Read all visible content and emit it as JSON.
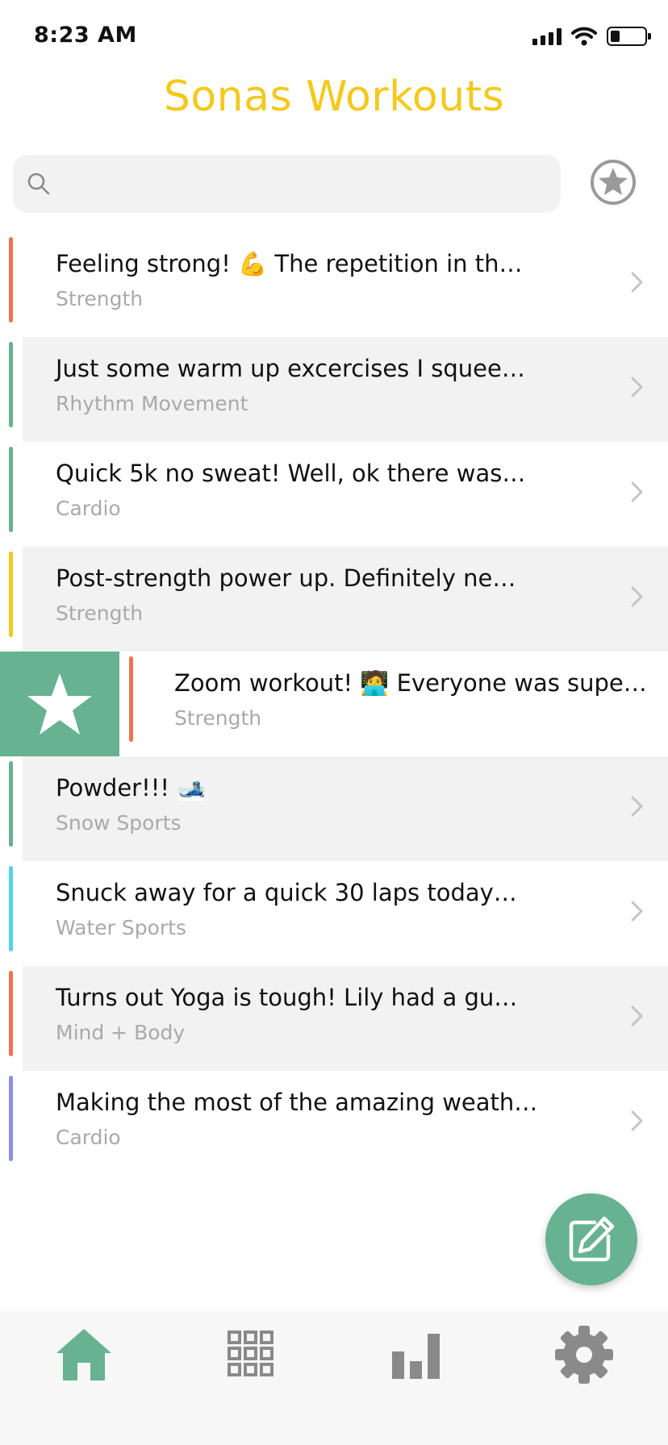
{
  "status_bar": {
    "time": "8:23 AM"
  },
  "header": {
    "title": "Sonas Workouts"
  },
  "search": {
    "placeholder": ""
  },
  "colors": {
    "accent_green": "#66b291",
    "title_yellow": "#f3c91d",
    "strength": "#f0734f",
    "rhythm": "#66b291",
    "cardio_green": "#66b291",
    "strength_yellow": "#f3c91d",
    "water": "#4fd3e8",
    "cardio_purple": "#8d8ee8"
  },
  "workouts": [
    {
      "title": "Feeling strong! 💪 The repetition in th…",
      "category": "Strength",
      "accent": "#f0734f"
    },
    {
      "title": "Just some warm up excercises I squee…",
      "category": "Rhythm Movement",
      "accent": "#66b291"
    },
    {
      "title": "Quick 5k no sweat! Well, ok there was…",
      "category": "Cardio",
      "accent": "#66b291"
    },
    {
      "title": "Post-strength power up. Definitely ne…",
      "category": "Strength",
      "accent": "#f3c91d"
    },
    {
      "title": "Zoom workout! 🧑‍💻 Everyone was supe…",
      "category": "Strength",
      "accent": "#f0734f"
    },
    {
      "title": "Powder!!! 🎿",
      "category": "Snow Sports",
      "accent": "#66b291"
    },
    {
      "title": "Snuck away for a quick 30 laps today…",
      "category": "Water Sports",
      "accent": "#4fd3e8"
    },
    {
      "title": "Turns out Yoga is tough! Lily had a gu…",
      "category": "Mind + Body",
      "accent": "#f0734f"
    },
    {
      "title": "Making the most of the amazing weath…",
      "category": "Cardio",
      "accent": "#8d8ee8"
    }
  ],
  "tabs": [
    {
      "icon": "home-icon",
      "active": true
    },
    {
      "icon": "grid-icon",
      "active": false
    },
    {
      "icon": "bar-chart-icon",
      "active": false
    },
    {
      "icon": "gear-icon",
      "active": false
    }
  ]
}
